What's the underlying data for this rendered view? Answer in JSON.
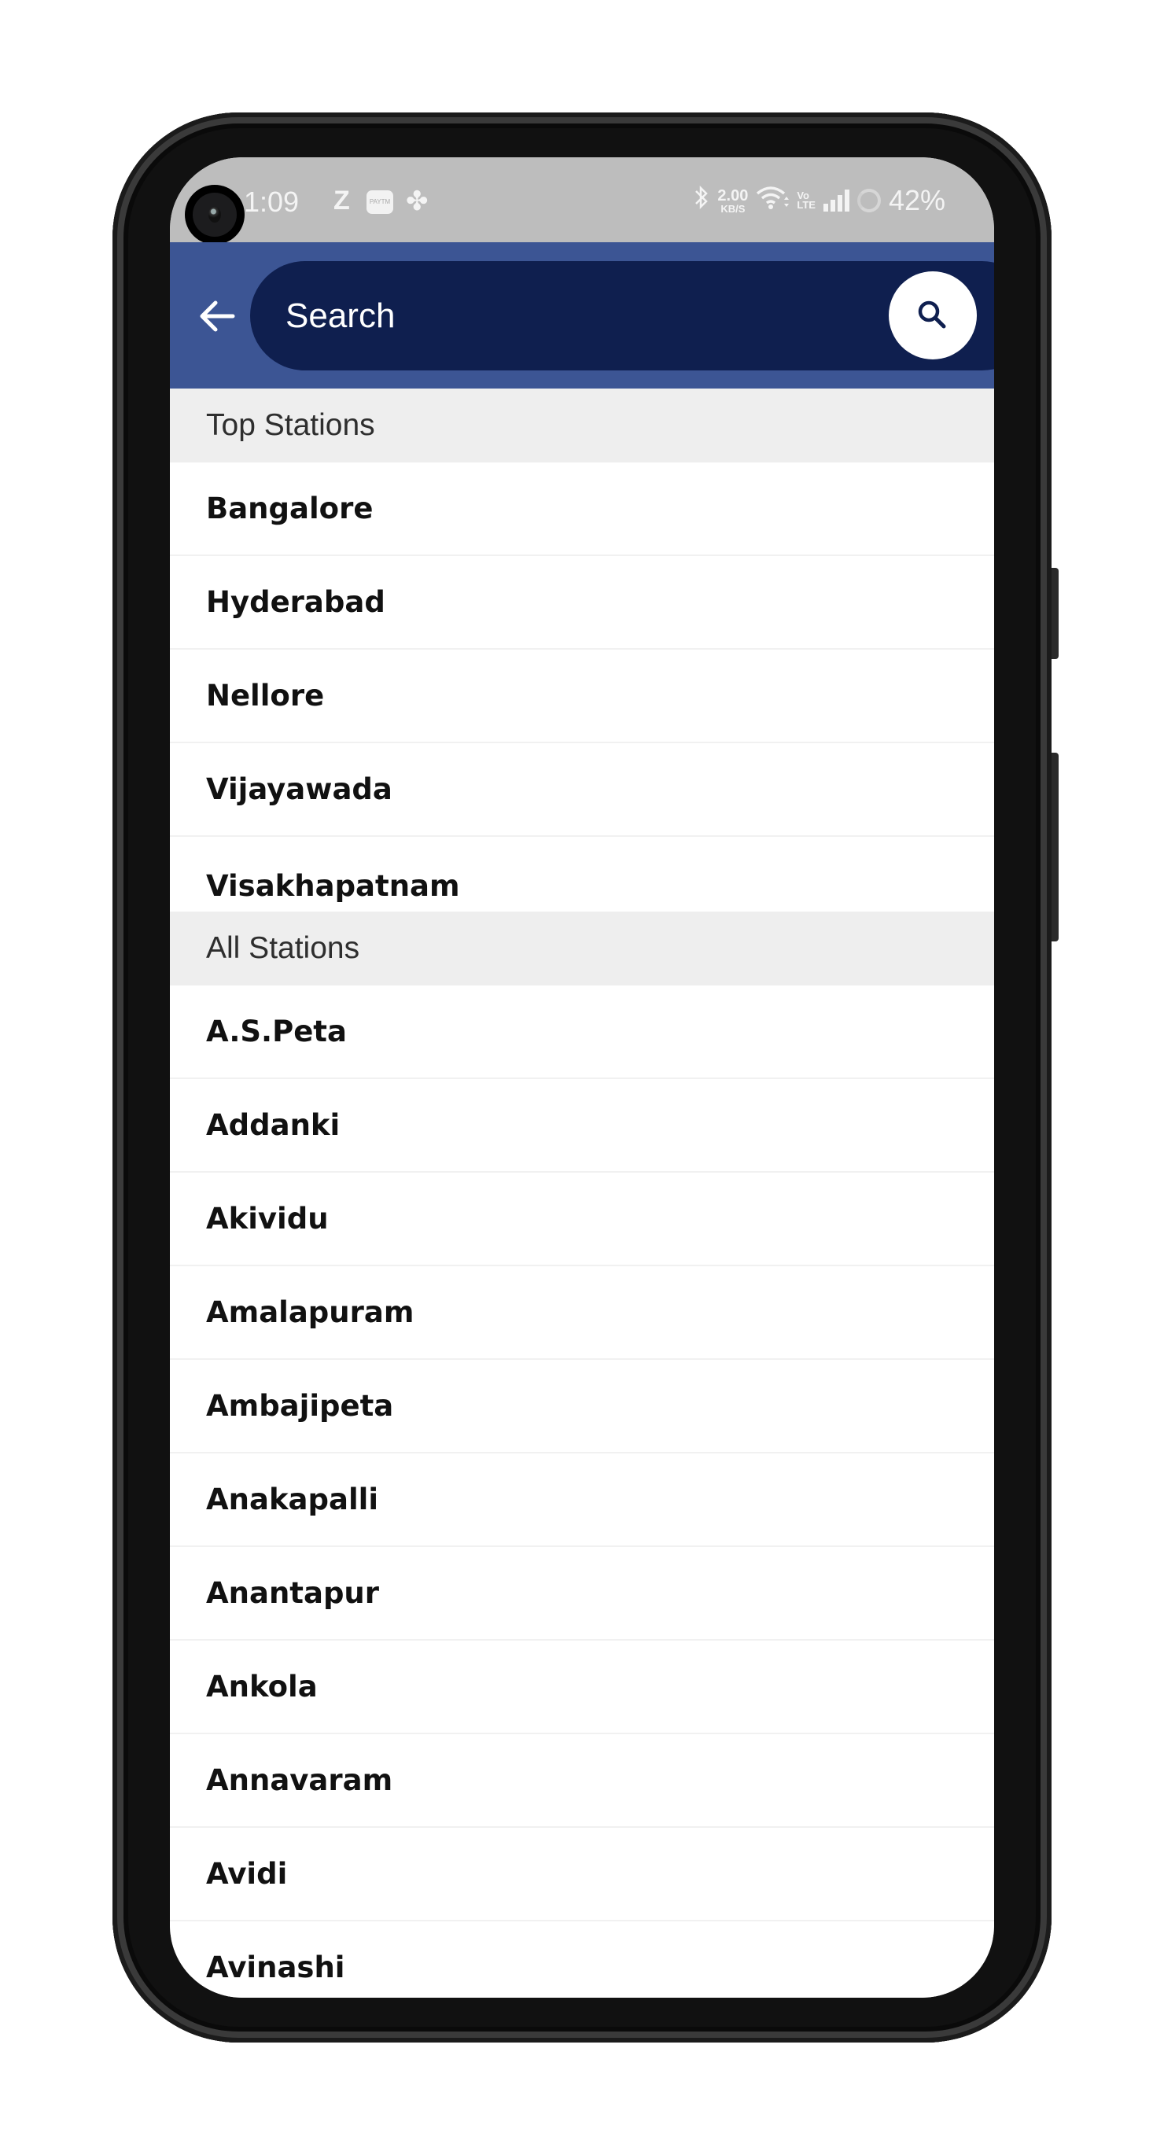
{
  "status_bar": {
    "time": "1:09",
    "left_icons": [
      "z-notification-icon",
      "paytm-icon",
      "fan-icon"
    ],
    "z_label": "Z",
    "paytm_label": "PAYTM",
    "network_speed_value": "2.00",
    "network_speed_unit": "KB/S",
    "volte_top": "Vo",
    "volte_bottom": "LTE",
    "battery": "42%",
    "right_icons": [
      "bluetooth-icon",
      "network-speed",
      "wifi-icon",
      "volte-icon",
      "signal-icon",
      "battery-icon"
    ]
  },
  "header": {
    "search_placeholder": "Search",
    "search_value": "",
    "back_icon": "arrow-left-icon",
    "search_icon": "magnifier-icon",
    "colors": {
      "bar": "#3c5594",
      "pill": "#0f1f4f",
      "button": "#ffffff"
    }
  },
  "sections": [
    {
      "title": "Top Stations",
      "stations": [
        "Bangalore",
        "Hyderabad",
        "Nellore",
        "Vijayawada",
        "Visakhapatnam"
      ]
    },
    {
      "title": "All Stations",
      "stations": [
        "A.S.Peta",
        "Addanki",
        "Akividu",
        "Amalapuram",
        "Ambajipeta",
        "Anakapalli",
        "Anantapur",
        "Ankola",
        "Annavaram",
        "Avidi",
        "Avinashi"
      ]
    }
  ]
}
